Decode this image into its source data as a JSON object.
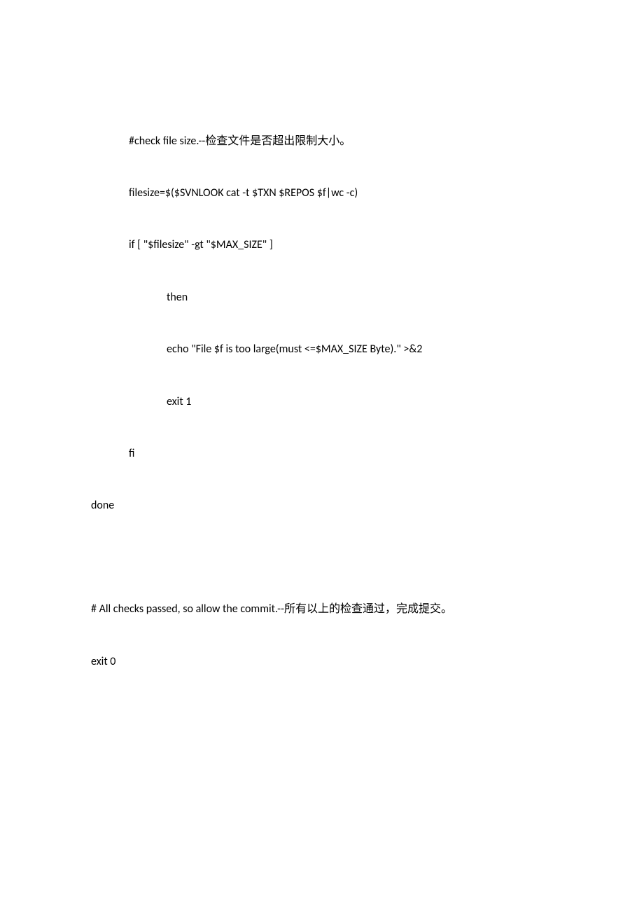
{
  "code": {
    "l1": "#check file size.--检查文件是否超出限制大小。",
    "l2": "filesize=$($SVNLOOK cat -t $TXN $REPOS $f|wc -c)",
    "l3": "if [ \"$filesize\" -gt \"$MAX_SIZE\" ]",
    "l4": "then",
    "l5": "echo \"File $f is too large(must <=$MAX_SIZE Byte).\" >&2",
    "l6": "exit 1",
    "l7": "fi",
    "l8": "done",
    "l9": "# All checks passed, so allow the commit.--所有以上的检查通过，完成提交。",
    "l10": "exit 0"
  }
}
